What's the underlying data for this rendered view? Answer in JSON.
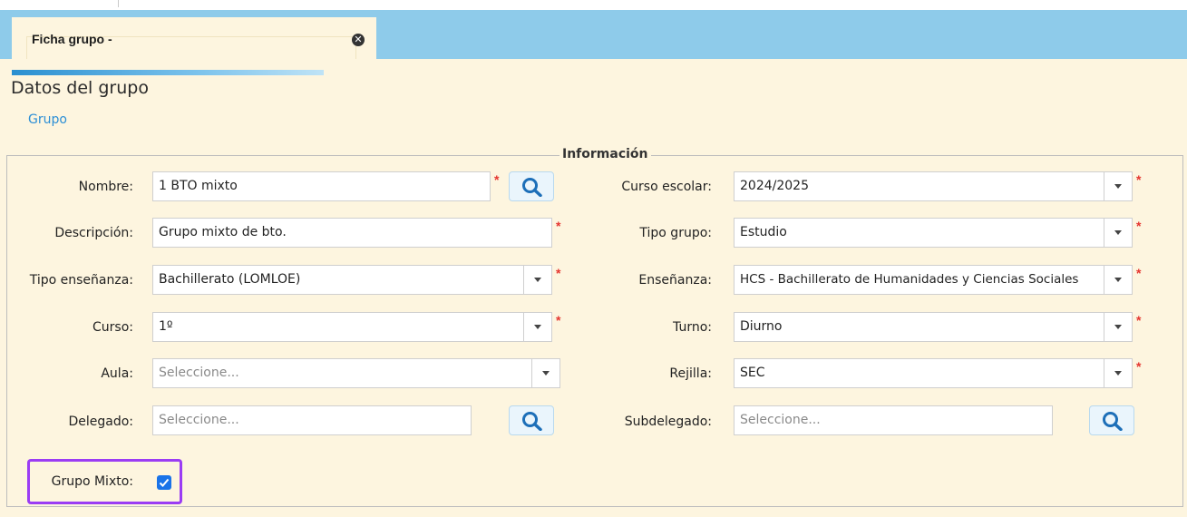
{
  "tab": {
    "title": "Ficha grupo -"
  },
  "page": {
    "title": "Datos del grupo",
    "breadcrumb": "Grupo"
  },
  "section": {
    "legend": "Información"
  },
  "form": {
    "nombre": {
      "label": "Nombre:",
      "value": "1 BTO mixto"
    },
    "descripcion": {
      "label": "Descripción:",
      "value": "Grupo mixto de bto."
    },
    "tipo_ensenanza": {
      "label": "Tipo enseñanza:",
      "value": "Bachillerato (LOMLOE)"
    },
    "curso": {
      "label": "Curso:",
      "value": "1º"
    },
    "aula": {
      "label": "Aula:",
      "placeholder": "Seleccione..."
    },
    "delegado": {
      "label": "Delegado:",
      "placeholder": "Seleccione..."
    },
    "grupo_mixto": {
      "label": "Grupo Mixto:",
      "checked": true
    },
    "curso_escolar": {
      "label": "Curso escolar:",
      "value": "2024/2025"
    },
    "tipo_grupo": {
      "label": "Tipo grupo:",
      "value": "Estudio"
    },
    "ensenanza": {
      "label": "Enseñanza:",
      "value": "HCS - Bachillerato de Humanidades y Ciencias Sociales"
    },
    "turno": {
      "label": "Turno:",
      "value": "Diurno"
    },
    "rejilla": {
      "label": "Rejilla:",
      "value": "SEC"
    },
    "subdelegado": {
      "label": "Subdelegado:",
      "placeholder": "Seleccione..."
    }
  },
  "required_mark": "*",
  "icons": {
    "search": "search-icon",
    "close": "close-icon",
    "caret": "chevron-down-icon",
    "check": "check-icon"
  },
  "colors": {
    "tabbar": "#8ecbea",
    "content_bg": "#fdf5df",
    "link": "#2c8fd6",
    "required": "#e5352f",
    "highlight": "#9b3cf4",
    "checkbox": "#1a73e8"
  }
}
